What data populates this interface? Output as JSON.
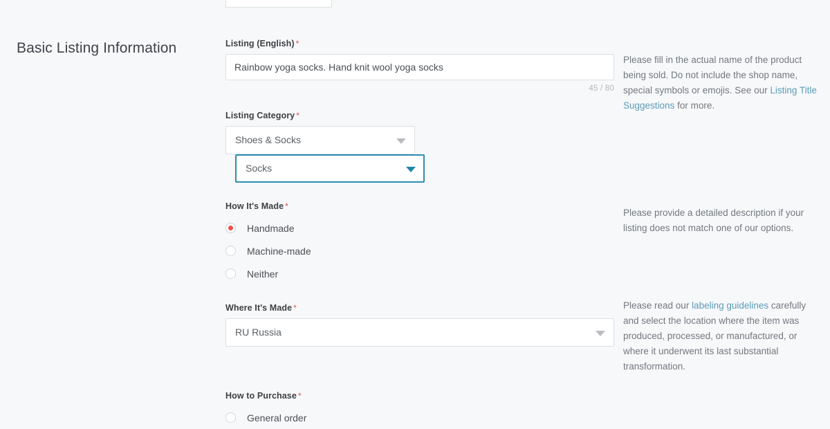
{
  "section": {
    "title": "Basic Listing Information"
  },
  "fields": {
    "listing_title": {
      "label": "Listing (English)",
      "required_marker": "*",
      "value": "Rainbow yoga socks. Hand knit wool yoga socks",
      "placeholder": "",
      "counter": "45 / 80",
      "help": {
        "text_before": "Please fill in the actual name of the product being sold. Do not include the shop name, special symbols or emojis. See our ",
        "link": "Listing Title Suggestions",
        "text_after": " for more."
      }
    },
    "listing_category": {
      "label": "Listing Category",
      "required_marker": "*",
      "primary_value": "Shoes & Socks",
      "secondary_value": "Socks",
      "focused": "secondary"
    },
    "how_its_made": {
      "label": "How It's Made",
      "required_marker": "*",
      "options": [
        {
          "label": "Handmade",
          "selected": true
        },
        {
          "label": "Machine-made",
          "selected": false
        },
        {
          "label": "Neither",
          "selected": false
        }
      ],
      "help": {
        "text_before": "Please provide a detailed description if your listing does not match one of our options.",
        "link": "",
        "text_after": ""
      }
    },
    "where_its_made": {
      "label": "Where It's Made",
      "required_marker": "*",
      "value": "RU Russia",
      "help": {
        "text_before": "Please read our ",
        "link": "labeling guidelines",
        "text_after": " carefully and select the location where the item was produced, processed, or manufactured, or where it underwent its last substantial transformation."
      }
    },
    "how_to_purchase": {
      "label": "How to Purchase",
      "required_marker": "*",
      "options": [
        {
          "label": "General order",
          "selected": false
        }
      ]
    }
  },
  "colors": {
    "page_background": "#f7f8fa",
    "focus_border": "#2e8cb0",
    "focus_arrow": "#2285ab",
    "radio_selected": "#ef4f45",
    "required_asterisk": "#d9534f",
    "link": "#5b9cb8",
    "help_text": "#72787e",
    "input_border": "#dcdfe3"
  }
}
